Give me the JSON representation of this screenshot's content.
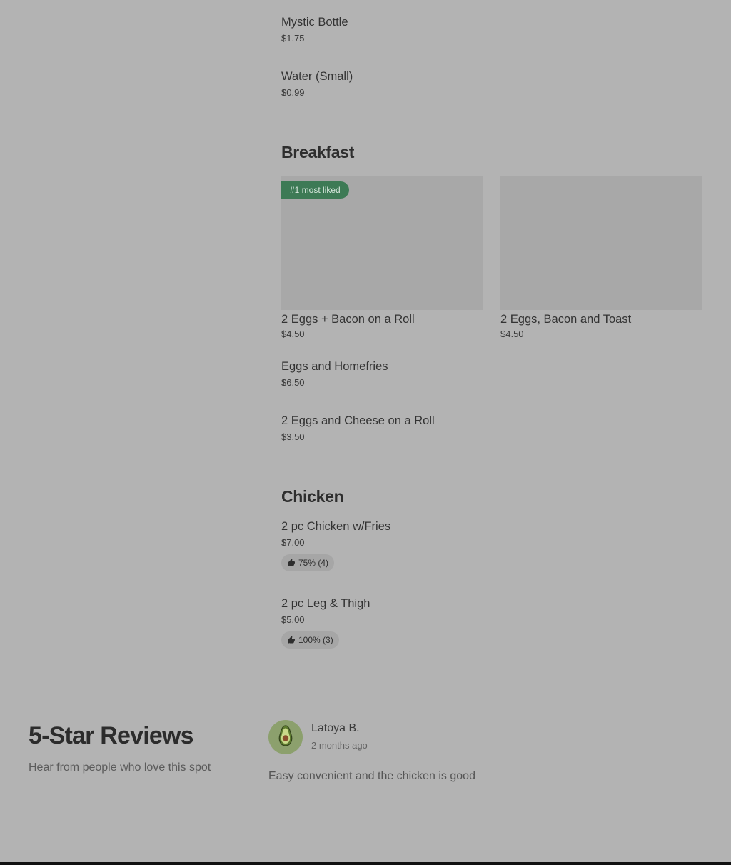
{
  "menu": {
    "drinks": {
      "items": [
        {
          "name": "Mystic Bottle",
          "price": "$1.75"
        },
        {
          "name": "Water (Small)",
          "price": "$0.99"
        }
      ]
    },
    "breakfast": {
      "title": "Breakfast",
      "featured": [
        {
          "name": "2 Eggs + Bacon on a Roll",
          "price": "$4.50",
          "badge": "#1 most liked"
        },
        {
          "name": "2 Eggs, Bacon and Toast",
          "price": "$4.50"
        }
      ],
      "items": [
        {
          "name": "Eggs and Homefries",
          "price": "$6.50"
        },
        {
          "name": "2 Eggs and Cheese on a Roll",
          "price": "$3.50"
        }
      ]
    },
    "chicken": {
      "title": "Chicken",
      "items": [
        {
          "name": "2 pc Chicken w/Fries",
          "price": "$7.00",
          "rating": "75% (4)"
        },
        {
          "name": "2 pc Leg & Thigh",
          "price": "$5.00",
          "rating": "100% (3)"
        }
      ]
    }
  },
  "reviews": {
    "title": "5-Star Reviews",
    "subtitle": "Hear from people who love this spot",
    "items": [
      {
        "author": "Latoya B.",
        "time": "2 months ago",
        "text": "Easy convenient and the chicken is good",
        "avatar_icon": "avocado-icon"
      }
    ]
  },
  "icons": {
    "rating": "thumbs-up-icon"
  },
  "colors": {
    "badge": "#3d7a55",
    "avatar": "#8ca06d",
    "overlay_background": "#b3b3b3"
  }
}
